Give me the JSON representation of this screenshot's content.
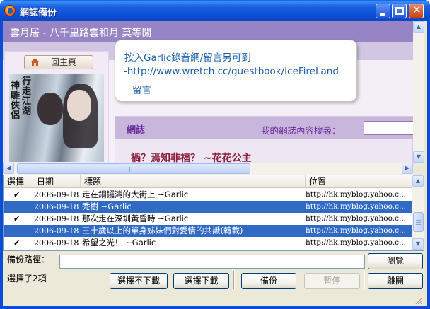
{
  "window": {
    "title": "網誌備份"
  },
  "blog": {
    "title": "雲月居 - 八千里路雲和月 莫等閒",
    "home_button": "回主頁",
    "poster_text_1": "神雕俠侶",
    "poster_text_2": "行走江湖",
    "bubble_line_1": "按入Garlic錄音網/留言另可到",
    "bubble_line_2": "-http://www.wretch.cc/guestbook/IceFireLand",
    "bubble_line_3": "留言",
    "section_label": "網誌",
    "search_label": "我的網誌內容搜尋：",
    "post_title": "禍？焉知非福？ ~花花公主"
  },
  "list": {
    "columns": {
      "select": "選擇",
      "date": "日期",
      "title": "標題",
      "location": "位置"
    },
    "rows": [
      {
        "checked": "✔",
        "date": "2006-09-18",
        "title": "走在銅鑼灣的大街上 ~Garlic",
        "url": "http://hk.myblog.yahoo.c...",
        "selected": false
      },
      {
        "checked": "",
        "date": "2006-09-18",
        "title": "禿樹 ~Garlic",
        "url": "http://hk.myblog.yahoo.c...",
        "selected": true
      },
      {
        "checked": "✔",
        "date": "2006-09-18",
        "title": "那次走在深圳黃昏時 ~Garlic",
        "url": "http://hk.myblog.yahoo.c...",
        "selected": false
      },
      {
        "checked": "",
        "date": "2006-09-18",
        "title": "三十歲以上的單身姊妹們對愛情的共識(轉載)",
        "url": "http://hk.myblog.yahoo.c...",
        "selected": true
      },
      {
        "checked": "✔",
        "date": "2006-09-18",
        "title": "希望之光！ ~Garlic",
        "url": "http://hk.myblog.yahoo.c...",
        "selected": false
      }
    ]
  },
  "bottom": {
    "path_label": "備份路徑：",
    "path_value": "",
    "browse_button": "瀏覽",
    "status_text": "選擇了2項",
    "deselect_button": "選擇不下載",
    "select_button": "選擇下載",
    "backup_button": "備份",
    "pause_button": "暫停",
    "exit_button": "離開"
  }
}
